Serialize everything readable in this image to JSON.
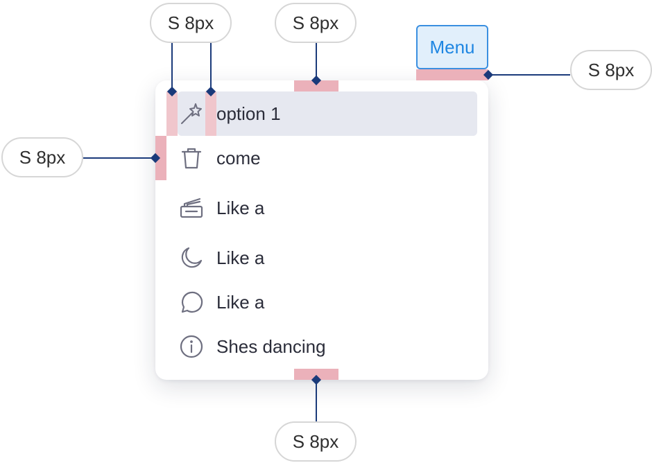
{
  "annotations": {
    "top_left_a": "S 8px",
    "top_center": "S 8px",
    "right": "S 8px",
    "left": "S 8px",
    "bottom": "S 8px"
  },
  "menu_button": {
    "label": "Menu",
    "accent": "#1e86e2"
  },
  "menu": {
    "items": [
      {
        "icon": "magic-wand-icon",
        "label": "option 1",
        "selected": true
      },
      {
        "icon": "trash-icon",
        "label": "come",
        "selected": false
      },
      {
        "icon": "inbox-icon",
        "label": "Like a",
        "selected": false
      },
      {
        "icon": "moon-icon",
        "label": "Like a",
        "selected": false
      },
      {
        "icon": "chat-bubble-icon",
        "label": "Like a",
        "selected": false
      },
      {
        "icon": "info-icon",
        "label": "Shes dancing",
        "selected": false
      }
    ]
  },
  "colors": {
    "spacing_highlight": "#f0c6cc",
    "connector": "#1a3a7a",
    "selected_row": "#e6e8f0"
  }
}
